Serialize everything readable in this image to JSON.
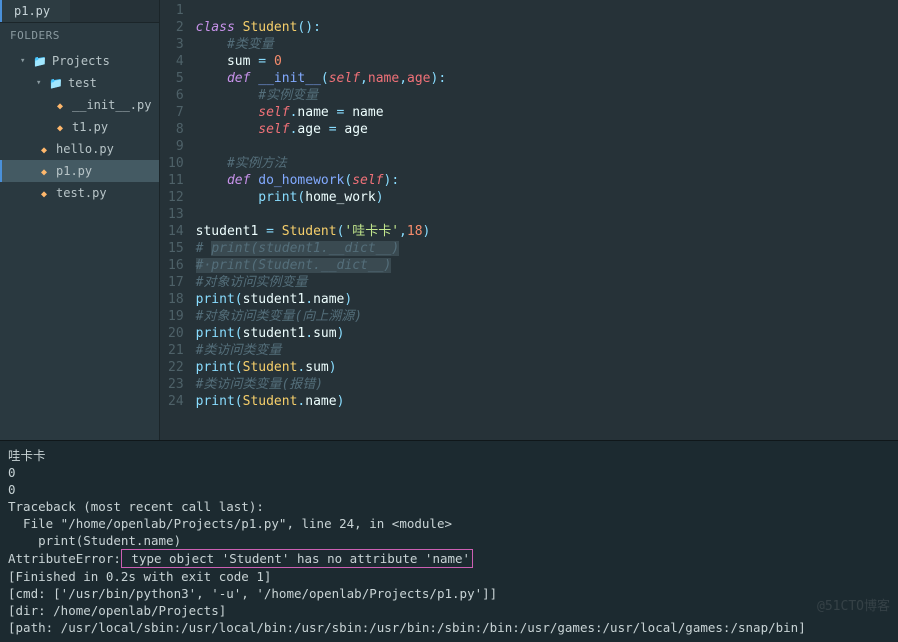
{
  "tab": {
    "label": "p1.py"
  },
  "sidebar": {
    "header": "FOLDERS",
    "items": [
      {
        "label": "Projects",
        "depth": 1,
        "kind": "folder",
        "expandable": true
      },
      {
        "label": "test",
        "depth": 2,
        "kind": "folder",
        "expandable": true
      },
      {
        "label": "__init__.py",
        "depth": 3,
        "kind": "py"
      },
      {
        "label": "t1.py",
        "depth": 3,
        "kind": "py"
      },
      {
        "label": "hello.py",
        "depth": 2,
        "kind": "py"
      },
      {
        "label": "p1.py",
        "depth": 2,
        "kind": "py",
        "active": true
      },
      {
        "label": "test.py",
        "depth": 2,
        "kind": "py"
      }
    ]
  },
  "code": {
    "lines": [
      [],
      [
        {
          "t": "class ",
          "c": "kw"
        },
        {
          "t": "Student",
          "c": "cls"
        },
        {
          "t": "()",
          "c": "pun"
        },
        {
          "t": ":",
          "c": "op"
        }
      ],
      [
        {
          "t": "    #类变量",
          "c": "cmt"
        }
      ],
      [
        {
          "t": "    ",
          "c": ""
        },
        {
          "t": "sum",
          "c": "norm"
        },
        {
          "t": " = ",
          "c": "op"
        },
        {
          "t": "0",
          "c": "num"
        }
      ],
      [
        {
          "t": "    ",
          "c": ""
        },
        {
          "t": "def ",
          "c": "kw"
        },
        {
          "t": "__init__",
          "c": "fn"
        },
        {
          "t": "(",
          "c": "pun"
        },
        {
          "t": "self",
          "c": "selfc"
        },
        {
          "t": ",",
          "c": "pun"
        },
        {
          "t": "name",
          "c": "arg"
        },
        {
          "t": ",",
          "c": "pun"
        },
        {
          "t": "age",
          "c": "arg"
        },
        {
          "t": ")",
          "c": "pun"
        },
        {
          "t": ":",
          "c": "op"
        }
      ],
      [
        {
          "t": "        #实例变量",
          "c": "cmt"
        }
      ],
      [
        {
          "t": "        ",
          "c": ""
        },
        {
          "t": "self",
          "c": "selfc"
        },
        {
          "t": ".",
          "c": "op"
        },
        {
          "t": "name",
          "c": "prop"
        },
        {
          "t": " = ",
          "c": "op"
        },
        {
          "t": "name",
          "c": "norm"
        }
      ],
      [
        {
          "t": "        ",
          "c": ""
        },
        {
          "t": "self",
          "c": "selfc"
        },
        {
          "t": ".",
          "c": "op"
        },
        {
          "t": "age",
          "c": "prop"
        },
        {
          "t": " = ",
          "c": "op"
        },
        {
          "t": "age",
          "c": "norm"
        }
      ],
      [],
      [
        {
          "t": "    #实例方法",
          "c": "cmt"
        }
      ],
      [
        {
          "t": "    ",
          "c": ""
        },
        {
          "t": "def ",
          "c": "kw"
        },
        {
          "t": "do_homework",
          "c": "fn"
        },
        {
          "t": "(",
          "c": "pun"
        },
        {
          "t": "self",
          "c": "selfc"
        },
        {
          "t": ")",
          "c": "pun"
        },
        {
          "t": ":",
          "c": "op"
        }
      ],
      [
        {
          "t": "        ",
          "c": ""
        },
        {
          "t": "print",
          "c": "fnb"
        },
        {
          "t": "(",
          "c": "pun"
        },
        {
          "t": "home_work",
          "c": "norm"
        },
        {
          "t": ")",
          "c": "pun"
        }
      ],
      [],
      [
        {
          "t": "student1",
          "c": "norm"
        },
        {
          "t": " = ",
          "c": "op"
        },
        {
          "t": "Student",
          "c": "cls"
        },
        {
          "t": "(",
          "c": "pun"
        },
        {
          "t": "'哇卡卡'",
          "c": "str"
        },
        {
          "t": ",",
          "c": "pun"
        },
        {
          "t": "18",
          "c": "num"
        },
        {
          "t": ")",
          "c": "pun"
        }
      ],
      [
        {
          "t": "# ",
          "c": "cmt"
        },
        {
          "t": "print(student1.__dict__)",
          "c": "cmtsel"
        }
      ],
      [
        {
          "t": "#·print(Student.__dict__)",
          "c": "cmtsel"
        }
      ],
      [
        {
          "t": "#对象访问实例变量",
          "c": "cmt"
        }
      ],
      [
        {
          "t": "print",
          "c": "fnb"
        },
        {
          "t": "(",
          "c": "pun"
        },
        {
          "t": "student1",
          "c": "norm"
        },
        {
          "t": ".",
          "c": "op"
        },
        {
          "t": "name",
          "c": "prop"
        },
        {
          "t": ")",
          "c": "pun"
        }
      ],
      [
        {
          "t": "#对象访问类变量(向上溯源)",
          "c": "cmt"
        }
      ],
      [
        {
          "t": "print",
          "c": "fnb"
        },
        {
          "t": "(",
          "c": "pun"
        },
        {
          "t": "student1",
          "c": "norm"
        },
        {
          "t": ".",
          "c": "op"
        },
        {
          "t": "sum",
          "c": "prop"
        },
        {
          "t": ")",
          "c": "pun"
        }
      ],
      [
        {
          "t": "#类访问类变量",
          "c": "cmt"
        }
      ],
      [
        {
          "t": "print",
          "c": "fnb"
        },
        {
          "t": "(",
          "c": "pun"
        },
        {
          "t": "Student",
          "c": "cls"
        },
        {
          "t": ".",
          "c": "op"
        },
        {
          "t": "sum",
          "c": "prop"
        },
        {
          "t": ")",
          "c": "pun"
        }
      ],
      [
        {
          "t": "#类访问类变量(报错)",
          "c": "cmt"
        }
      ],
      [
        {
          "t": "print",
          "c": "fnb"
        },
        {
          "t": "(",
          "c": "pun"
        },
        {
          "t": "Student",
          "c": "cls"
        },
        {
          "t": ".",
          "c": "op"
        },
        {
          "t": "name",
          "c": "prop"
        },
        {
          "t": ")",
          "c": "pun"
        }
      ]
    ]
  },
  "console": {
    "lines": [
      "哇卡卡",
      "0",
      "0",
      "Traceback (most recent call last):",
      "  File \"/home/openlab/Projects/p1.py\", line 24, in <module>",
      "    print(Student.name)"
    ],
    "err_prefix": "AttributeError:",
    "err_box": " type object 'Student' has no attribute 'name'",
    "tail": [
      "[Finished in 0.2s with exit code 1]",
      "[cmd: ['/usr/bin/python3', '-u', '/home/openlab/Projects/p1.py']]",
      "[dir: /home/openlab/Projects]",
      "[path: /usr/local/sbin:/usr/local/bin:/usr/sbin:/usr/bin:/sbin:/bin:/usr/games:/usr/local/games:/snap/bin]"
    ]
  },
  "watermark": "@51CTO博客"
}
